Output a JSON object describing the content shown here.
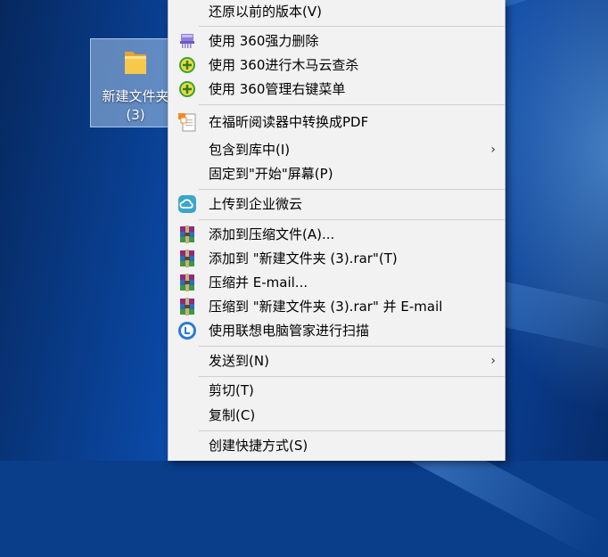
{
  "desktop": {
    "folder_name_line1": "新建文件夹",
    "folder_name_line2": "(3)"
  },
  "menu": {
    "items": [
      {
        "label": "还原以前的版本(V)",
        "icon": "none"
      },
      {
        "label": "使用 360强力删除",
        "icon": "360-shred-icon"
      },
      {
        "label": "使用 360进行木马云查杀",
        "icon": "360-scan-icon"
      },
      {
        "label": "使用 360管理右键菜单",
        "icon": "360-menu-icon"
      },
      {
        "label": "在福昕阅读器中转换成PDF",
        "icon": "foxit-pdf-icon"
      },
      {
        "label": "包含到库中(I)",
        "icon": "none",
        "submenu": "›"
      },
      {
        "label": "固定到\"开始\"屏幕(P)",
        "icon": "none"
      },
      {
        "label": "上传到企业微云",
        "icon": "weiyun-cloud-icon"
      },
      {
        "label": "添加到压缩文件(A)...",
        "icon": "winrar-icon"
      },
      {
        "label": "添加到 \"新建文件夹 (3).rar\"(T)",
        "icon": "winrar-icon"
      },
      {
        "label": "压缩并 E-mail...",
        "icon": "winrar-icon"
      },
      {
        "label": "压缩到 \"新建文件夹 (3).rar\" 并 E-mail",
        "icon": "winrar-icon"
      },
      {
        "label": "使用联想电脑管家进行扫描",
        "icon": "lenovo-manager-icon"
      },
      {
        "label": "发送到(N)",
        "icon": "none",
        "submenu": "›"
      },
      {
        "label": "剪切(T)",
        "icon": "none"
      },
      {
        "label": "复制(C)",
        "icon": "none"
      },
      {
        "label": "创建快捷方式(S)",
        "icon": "none"
      }
    ]
  },
  "colors": {
    "menu_bg": "#f2f2f2",
    "desktop_blue": "#0b4aa8",
    "folder_yellow": "#f6c94a",
    "green_360": "#35a336",
    "lenovo_blue": "#2b79d6"
  }
}
